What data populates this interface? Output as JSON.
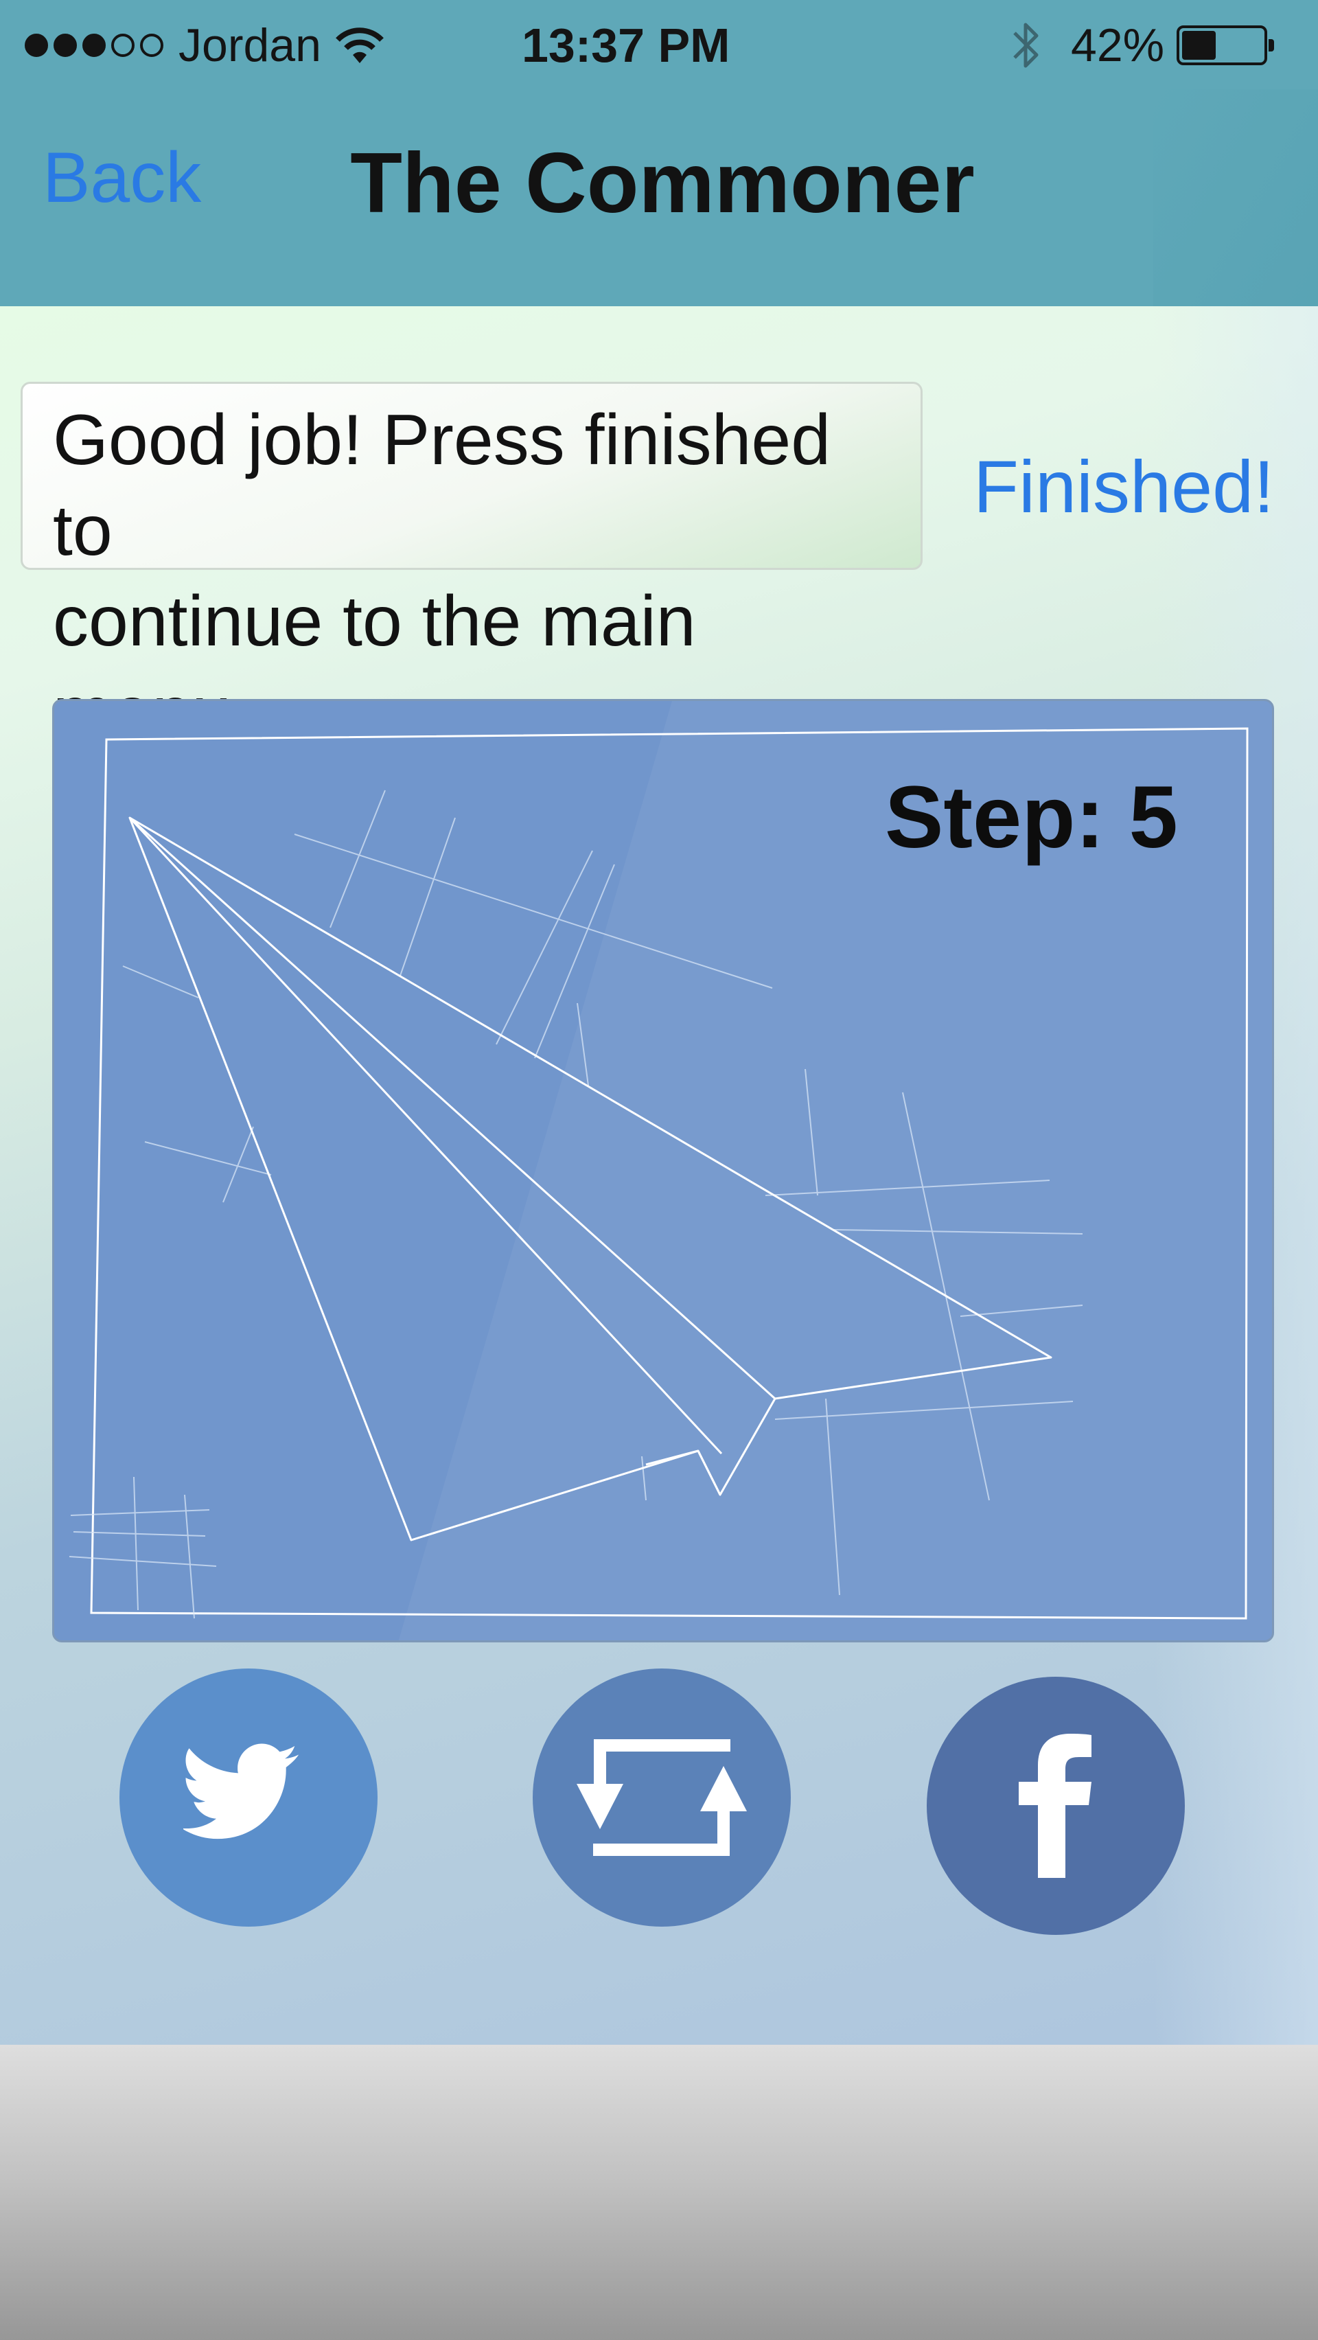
{
  "status_bar": {
    "signal_filled": 3,
    "signal_total": 5,
    "carrier": "Jordan",
    "time": "13:37 PM",
    "battery_text": "42%",
    "battery_level": 0.42
  },
  "nav": {
    "back_label": "Back",
    "title": "The Commoner"
  },
  "message": {
    "line1": "Good job! Press finished to",
    "line2": "continue to the main menu."
  },
  "finished_label": "Finished!",
  "blueprint": {
    "step_label": "Step: 5"
  },
  "share": {
    "twitter_icon": "twitter-bird-icon",
    "repost_icon": "repost-arrows-icon",
    "facebook_icon": "facebook-f-icon"
  },
  "colors": {
    "nav_bg": "#5fa8b8",
    "link": "#2a7ae4",
    "blueprint_bg": "#7196cc"
  }
}
